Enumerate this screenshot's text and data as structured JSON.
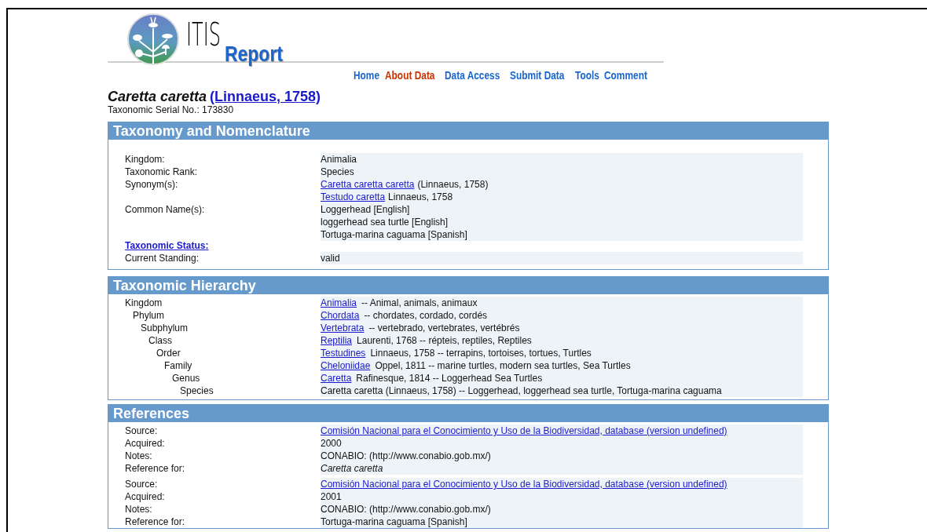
{
  "header": {
    "logo_text": "ITIS",
    "report_title": "Report"
  },
  "nav": [
    {
      "label": "Home",
      "selected": false
    },
    {
      "label": "About Data",
      "selected": true
    },
    {
      "label": "Data Access",
      "selected": false
    },
    {
      "label": "Submit Data",
      "selected": false
    },
    {
      "label": "Tools",
      "selected": false
    },
    {
      "label": "Comment",
      "selected": false
    }
  ],
  "species": {
    "name": "Caretta caretta",
    "author": "(Linnaeus, 1758)",
    "serial": "Taxonomic Serial No.: 173830"
  },
  "taxonomy": {
    "title": "Taxonomy and Nomenclature",
    "rows": [
      {
        "kind": "field",
        "label": "Kingdom:",
        "lines": [
          [
            {
              "text": "Animalia",
              "link": false
            }
          ]
        ]
      },
      {
        "kind": "field",
        "label": "Taxonomic Rank:",
        "lines": [
          [
            {
              "text": "Species",
              "link": false
            }
          ]
        ]
      },
      {
        "kind": "field",
        "label": "Synonym(s):",
        "lines": [
          [
            {
              "text": "Caretta caretta caretta",
              "link": true
            },
            {
              "text": "(Linnaeus, 1758)",
              "link": false
            }
          ],
          [
            {
              "text": "Testudo caretta",
              "link": true
            },
            {
              "text": "Linnaeus, 1758",
              "link": false
            }
          ]
        ]
      },
      {
        "kind": "field",
        "label": "Common Name(s):",
        "lines": [
          [
            {
              "text": "Loggerhead [English]",
              "link": false
            }
          ],
          [
            {
              "text": "loggerhead sea turtle [English]",
              "link": false
            }
          ],
          [
            {
              "text": "Tortuga-marina caguama [Spanish]",
              "link": false
            }
          ]
        ]
      },
      {
        "kind": "heading",
        "label": "Taxonomic Status:"
      },
      {
        "kind": "field",
        "label": "Current Standing:",
        "lines": [
          [
            {
              "text": "valid",
              "link": false
            }
          ]
        ]
      }
    ]
  },
  "hierarchy": {
    "title": "Taxonomic Hierarchy",
    "tree": [
      {
        "rank": "Kingdom",
        "name": "Animalia",
        "link": true,
        "detail": "-- Animal, animals, animaux",
        "children": [
          {
            "rank": "Phylum",
            "name": "Chordata",
            "link": true,
            "detail": "-- chordates, cordado, cordés",
            "children": [
              {
                "rank": "Subphylum",
                "name": "Vertebrata",
                "link": true,
                "detail": "-- vertebrado, vertebrates, vertébrés",
                "children": [
                  {
                    "rank": "Class",
                    "name": "Reptilia",
                    "link": true,
                    "detail": "Laurenti, 1768 -- répteis, reptiles, Reptiles",
                    "children": [
                      {
                        "rank": "Order",
                        "name": "Testudines",
                        "link": true,
                        "detail": "Linnaeus, 1758 -- terrapins, tortoises, tortues, Turtles",
                        "children": [
                          {
                            "rank": "Family",
                            "name": "Cheloniidae",
                            "link": true,
                            "detail": "Oppel, 1811 -- marine turtles, modern sea turtles, Sea Turtles",
                            "children": [
                              {
                                "rank": "Genus",
                                "name": "Caretta",
                                "link": true,
                                "detail": "Rafinesque, 1814 -- Loggerhead Sea Turtles",
                                "children": [
                                  {
                                    "rank": "Species",
                                    "name": "Caretta caretta (Linnaeus, 1758) -- Loggerhead, loggerhead sea turtle, Tortuga-marina caguama",
                                    "link": false
                                  }
                                ]
                              }
                            ]
                          }
                        ]
                      }
                    ]
                  }
                ]
              }
            ]
          }
        ]
      }
    ]
  },
  "references": {
    "title": "References",
    "groups": [
      {
        "rows": [
          {
            "kind": "link",
            "label": "Source:",
            "value": "Comisión Nacional para el Conocimiento y Uso de la Biodiversidad, database (version undefined)"
          },
          {
            "kind": "text",
            "label": "Acquired:",
            "value": "2000"
          },
          {
            "kind": "text",
            "label": "Notes:",
            "value": "CONABIO: (http://www.conabio.gob.mx/)"
          },
          {
            "kind": "italic",
            "label": "Reference for:",
            "value": "Caretta caretta"
          }
        ]
      },
      {
        "rows": [
          {
            "kind": "link",
            "label": "Source:",
            "value": "Comisión Nacional para el Conocimiento y Uso de la Biodiversidad, database (version undefined)"
          },
          {
            "kind": "text",
            "label": "Acquired:",
            "value": "2001"
          },
          {
            "kind": "text",
            "label": "Notes:",
            "value": "CONABIO: (http://www.conabio.gob.mx/)"
          },
          {
            "kind": "text",
            "label": "Reference for:",
            "value": "Tortuga-marina caguama [Spanish]"
          }
        ]
      }
    ]
  }
}
